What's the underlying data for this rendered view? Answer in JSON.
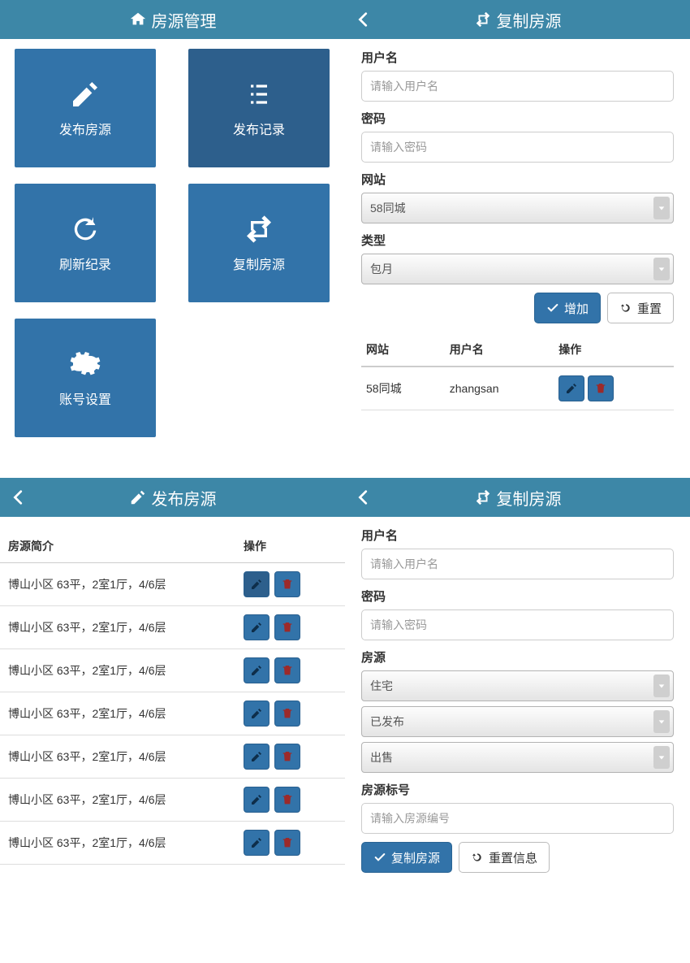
{
  "panel1": {
    "title": "房源管理",
    "tiles": [
      {
        "label": "发布房源",
        "icon": "pencil"
      },
      {
        "label": "发布记录",
        "icon": "list"
      },
      {
        "label": "刷新纪录",
        "icon": "refresh"
      },
      {
        "label": "复制房源",
        "icon": "retweet"
      },
      {
        "label": "账号设置",
        "icon": "gear"
      }
    ]
  },
  "panel2": {
    "title": "复制房源",
    "username_label": "用户名",
    "username_placeholder": "请输入用户名",
    "password_label": "密码",
    "password_placeholder": "请输入密码",
    "site_label": "网站",
    "site_value": "58同城",
    "type_label": "类型",
    "type_value": "包月",
    "add_btn": "增加",
    "reset_btn": "重置",
    "table": {
      "col_site": "网站",
      "col_user": "用户名",
      "col_ops": "操作",
      "rows": [
        {
          "site": "58同城",
          "user": "zhangsan"
        }
      ]
    }
  },
  "panel3": {
    "title": "发布房源",
    "col_summary": "房源简介",
    "col_ops": "操作",
    "rows": [
      {
        "summary": "博山小区 63平，2室1厅，4/6层",
        "active": true
      },
      {
        "summary": "博山小区 63平，2室1厅，4/6层",
        "active": false
      },
      {
        "summary": "博山小区 63平，2室1厅，4/6层",
        "active": false
      },
      {
        "summary": "博山小区 63平，2室1厅，4/6层",
        "active": false
      },
      {
        "summary": "博山小区 63平，2室1厅，4/6层",
        "active": false
      },
      {
        "summary": "博山小区 63平，2室1厅，4/6层",
        "active": false
      },
      {
        "summary": "博山小区 63平，2室1厅，4/6层",
        "active": false
      }
    ]
  },
  "panel4": {
    "title": "复制房源",
    "username_label": "用户名",
    "username_placeholder": "请输入用户名",
    "password_label": "密码",
    "password_placeholder": "请输入密码",
    "listing_label": "房源",
    "sel_type": "住宅",
    "sel_status": "已发布",
    "sel_deal": "出售",
    "code_label": "房源标号",
    "code_placeholder": "请输入房源编号",
    "copy_btn": "复制房源",
    "reset_btn": "重置信息"
  }
}
